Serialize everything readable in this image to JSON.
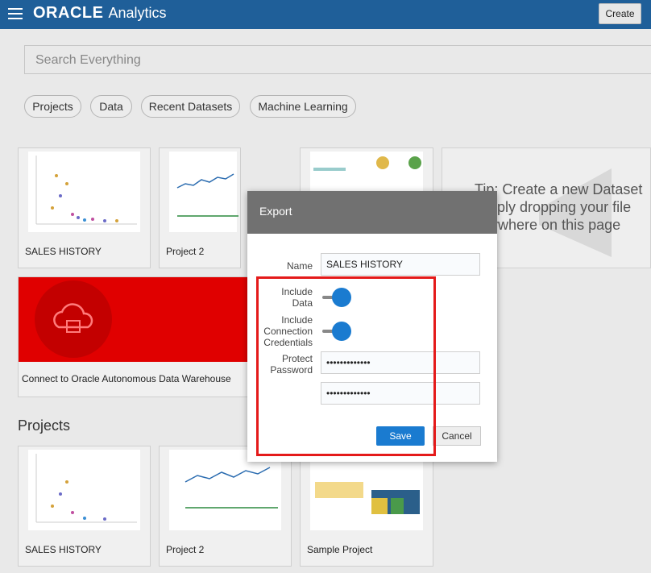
{
  "header": {
    "brand": "ORACLE",
    "product": "Analytics",
    "create_label": "Create"
  },
  "search": {
    "placeholder": "Search Everything"
  },
  "filters": [
    "Projects",
    "Data",
    "Recent Datasets",
    "Machine Learning"
  ],
  "recent_cards": [
    {
      "label": "SALES HISTORY"
    },
    {
      "label": "Project 2"
    }
  ],
  "tip": {
    "line1": "Tip: Create a new Dataset",
    "line2": "simply dropping your file",
    "line3": "anywhere on this page"
  },
  "adw_card": {
    "label": "Connect to Oracle Autonomous Data Warehouse"
  },
  "projects": {
    "title": "Projects",
    "items": [
      {
        "label": "SALES HISTORY"
      },
      {
        "label": "Project 2"
      },
      {
        "label": "Sample Project"
      }
    ]
  },
  "export_dialog": {
    "title": "Export",
    "name_label": "Name",
    "name_value": "SALES HISTORY",
    "include_data_label_1": "Include",
    "include_data_label_2": "Data",
    "include_creds_label_1": "Include",
    "include_creds_label_2": "Connection",
    "include_creds_label_3": "Credentials",
    "protect_label_1": "Protect",
    "protect_label_2": "Password",
    "password_value": "•••••••••••••",
    "confirm_value": "•••••••••••••",
    "save_label": "Save",
    "cancel_label": "Cancel"
  },
  "colors": {
    "topbar": "#1f5f99",
    "accent": "#1a7bd0",
    "highlight": "#e41a1a",
    "adw_red": "#e00000"
  }
}
